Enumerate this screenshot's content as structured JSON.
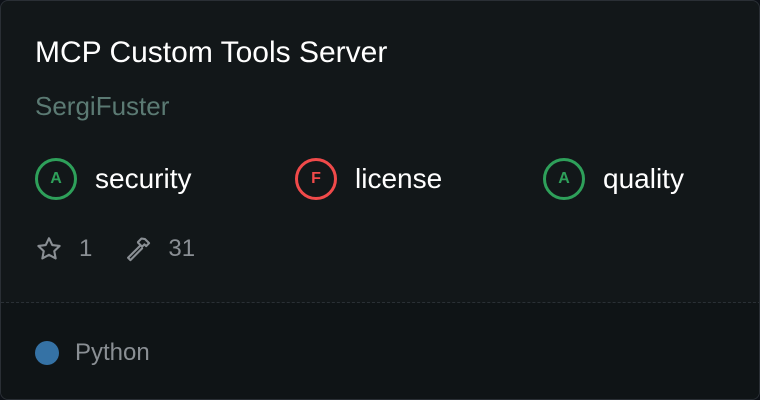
{
  "card": {
    "title": "MCP Custom Tools Server",
    "author": "SergiFuster"
  },
  "badges": [
    {
      "grade": "A",
      "label": "security",
      "color": "#2ea05a"
    },
    {
      "grade": "F",
      "label": "license",
      "color": "#f04a4a"
    },
    {
      "grade": "A",
      "label": "quality",
      "color": "#2ea05a"
    }
  ],
  "stats": {
    "stars": "1",
    "star_icon": "star-icon",
    "tools": "31",
    "tools_icon": "hammer-icon"
  },
  "footer": {
    "language": "Python",
    "language_color": "#3572a5"
  }
}
